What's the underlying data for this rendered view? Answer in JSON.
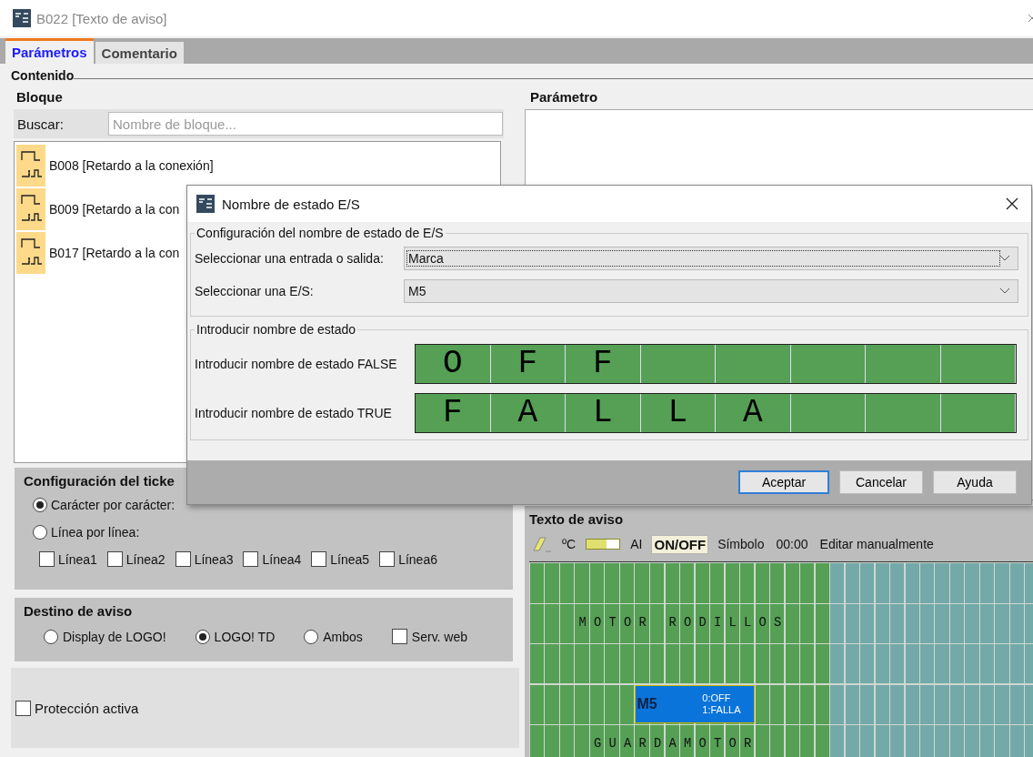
{
  "window": {
    "title": "B022 [Texto de aviso]"
  },
  "tabs": [
    {
      "label": "Parámetros",
      "selected": true
    },
    {
      "label": "Comentario",
      "selected": false
    }
  ],
  "content_legend": "Contenido",
  "block_panel": {
    "title": "Bloque",
    "search_label": "Buscar:",
    "search_placeholder": "Nombre de bloque...",
    "items": [
      {
        "label": "B008 [Retardo a la conexión]"
      },
      {
        "label": "B009 [Retardo a la con"
      },
      {
        "label": "B017 [Retardo a la con"
      }
    ]
  },
  "parameter_panel": {
    "title": "Parámetro"
  },
  "ticker": {
    "title": "Configuración del ticke",
    "options": [
      {
        "label": "Carácter por carácter:",
        "selected": true
      },
      {
        "label": "Línea por línea:",
        "selected": false
      }
    ],
    "lines": [
      {
        "label": "Línea1",
        "checked": false
      },
      {
        "label": "Línea2",
        "checked": false
      },
      {
        "label": "Línea3",
        "checked": false
      },
      {
        "label": "Línea4",
        "checked": false
      },
      {
        "label": "Línea5",
        "checked": false
      },
      {
        "label": "Línea6",
        "checked": false
      }
    ]
  },
  "destination": {
    "title": "Destino de aviso",
    "options": [
      {
        "label": "Display de LOGO!",
        "selected": false
      },
      {
        "label": "LOGO! TD",
        "selected": true
      },
      {
        "label": "Ambos",
        "selected": false
      }
    ],
    "web_server": {
      "label": "Serv. web",
      "checked": false
    }
  },
  "protection": {
    "label": "Protección activa",
    "checked": false
  },
  "message_text": {
    "title": "Texto de aviso",
    "toolbar": [
      {
        "kind": "eraser",
        "selected": false
      },
      {
        "kind": "text",
        "label": "ºC",
        "selected": false
      },
      {
        "kind": "bar",
        "selected": false
      },
      {
        "kind": "text",
        "label": "AI",
        "selected": false
      },
      {
        "kind": "text",
        "label": "ON/OFF",
        "selected": true
      },
      {
        "kind": "text",
        "label": "Símbolo",
        "selected": false
      },
      {
        "kind": "text",
        "label": "00:00",
        "selected": false
      },
      {
        "kind": "text",
        "label": "Editar manualmente",
        "selected": false
      }
    ],
    "display": {
      "lines": [
        {
          "text": "M O T O R   R O D I L L O S"
        },
        {
          "text": "G U A R D A M O T O R"
        }
      ],
      "tags": [
        {
          "name": "M5",
          "states": [
            "0:OFF",
            "1:FALLA"
          ]
        }
      ]
    }
  },
  "dialog": {
    "title": "Nombre de estado E/S",
    "io_group": {
      "legend": "Configuración del nombre de estado de E/S",
      "fields": [
        {
          "label": "Seleccionar una entrada o salida:",
          "value": "Marca",
          "focused": true
        },
        {
          "label": "Seleccionar una E/S:",
          "value": "M5",
          "focused": false
        }
      ]
    },
    "state_group": {
      "legend": "Introducir nombre de estado",
      "fields": [
        {
          "label": "Introducir nombre de estado FALSE",
          "value": "O F F"
        },
        {
          "label": "Introducir nombre de estado TRUE",
          "value": "F A L L A"
        }
      ]
    },
    "buttons": [
      {
        "label": "Aceptar",
        "default": true
      },
      {
        "label": "Cancelar",
        "default": false
      },
      {
        "label": "Ayuda",
        "default": false
      }
    ]
  }
}
